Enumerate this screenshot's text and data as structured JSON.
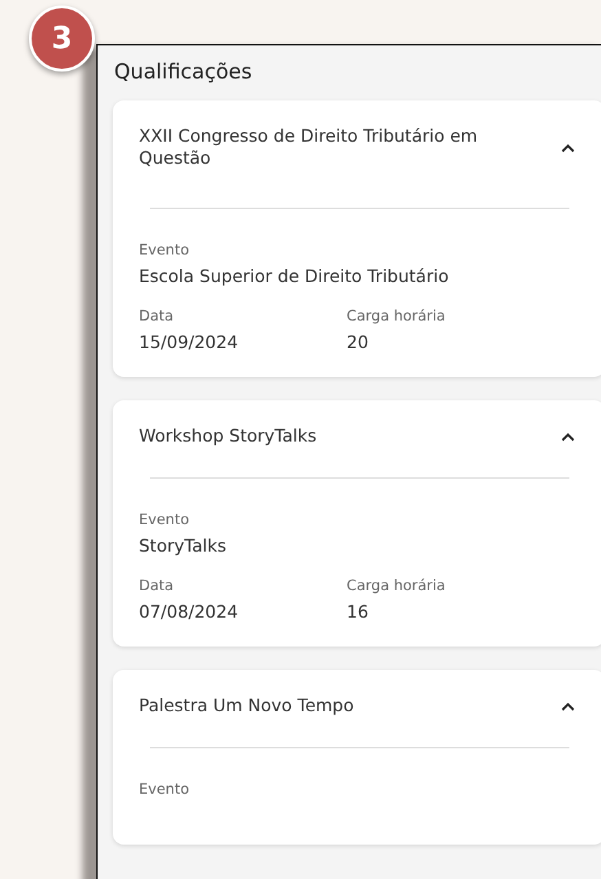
{
  "step_badge": "3",
  "section": {
    "title": "Qualificações"
  },
  "cards": [
    {
      "title": "XXII Congresso de Direito Tributário em Questão",
      "expanded": true,
      "fields": [
        {
          "label": "Evento",
          "value": "Escola Superior de Direito Tributário"
        }
      ],
      "pair": [
        {
          "label": "Data",
          "value": "15/09/2024"
        },
        {
          "label": "Carga horária",
          "value": "20"
        }
      ]
    },
    {
      "title": "Workshop StoryTalks",
      "expanded": true,
      "fields": [
        {
          "label": "Evento",
          "value": "StoryTalks"
        }
      ],
      "pair": [
        {
          "label": "Data",
          "value": "07/08/2024"
        },
        {
          "label": "Carga horária",
          "value": "16"
        }
      ]
    },
    {
      "title": "Palestra Um Novo Tempo",
      "expanded": true,
      "fields": [
        {
          "label": "Evento"
        }
      ]
    }
  ]
}
